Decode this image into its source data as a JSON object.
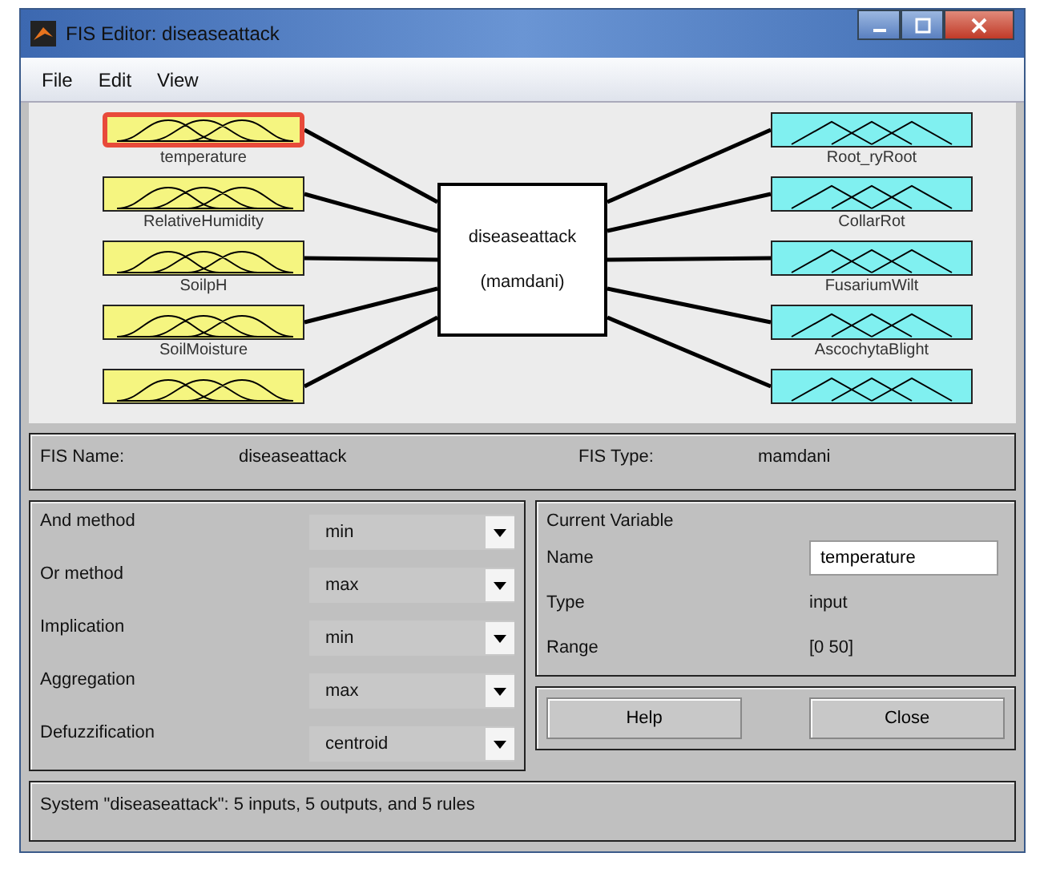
{
  "window": {
    "title": "FIS Editor: diseaseattack"
  },
  "menu": [
    "File",
    "Edit",
    "View"
  ],
  "diagram": {
    "inputs": [
      {
        "label": "temperature",
        "selected": true
      },
      {
        "label": "RelativeHumidity",
        "selected": false
      },
      {
        "label": "SoilpH",
        "selected": false
      },
      {
        "label": "SoilMoisture",
        "selected": false
      },
      {
        "selected": false
      }
    ],
    "system": {
      "name": "diseaseattack",
      "type": "(mamdani)"
    },
    "outputs": [
      {
        "label": "Root_ryRoot",
        "selected": false
      },
      {
        "label": "CollarRot",
        "selected": false
      },
      {
        "label": "FusariumWilt",
        "selected": false
      },
      {
        "label": "AscochytaBlight",
        "selected": false
      },
      {
        "selected": false
      }
    ]
  },
  "fis": {
    "name_label": "FIS Name:",
    "name": "diseaseattack",
    "type_label": "FIS Type:",
    "type": "mamdani"
  },
  "methods": [
    {
      "label": "And method",
      "value": "min"
    },
    {
      "label": "Or method",
      "value": "max"
    },
    {
      "label": "Implication",
      "value": "min"
    },
    {
      "label": "Aggregation",
      "value": "max"
    },
    {
      "label": "Defuzzification",
      "value": "centroid"
    }
  ],
  "current_variable": {
    "title": "Current Variable",
    "fields": [
      {
        "label": "Name",
        "value": "temperature",
        "kind": "input"
      },
      {
        "label": "Type",
        "value": "input",
        "kind": "text"
      },
      {
        "label": "Range",
        "value": "[0 50]",
        "kind": "text"
      }
    ]
  },
  "buttons": [
    "Help",
    "Close"
  ],
  "status": "System \"diseaseattack\": 5 inputs, 5 outputs, and 5 rules"
}
